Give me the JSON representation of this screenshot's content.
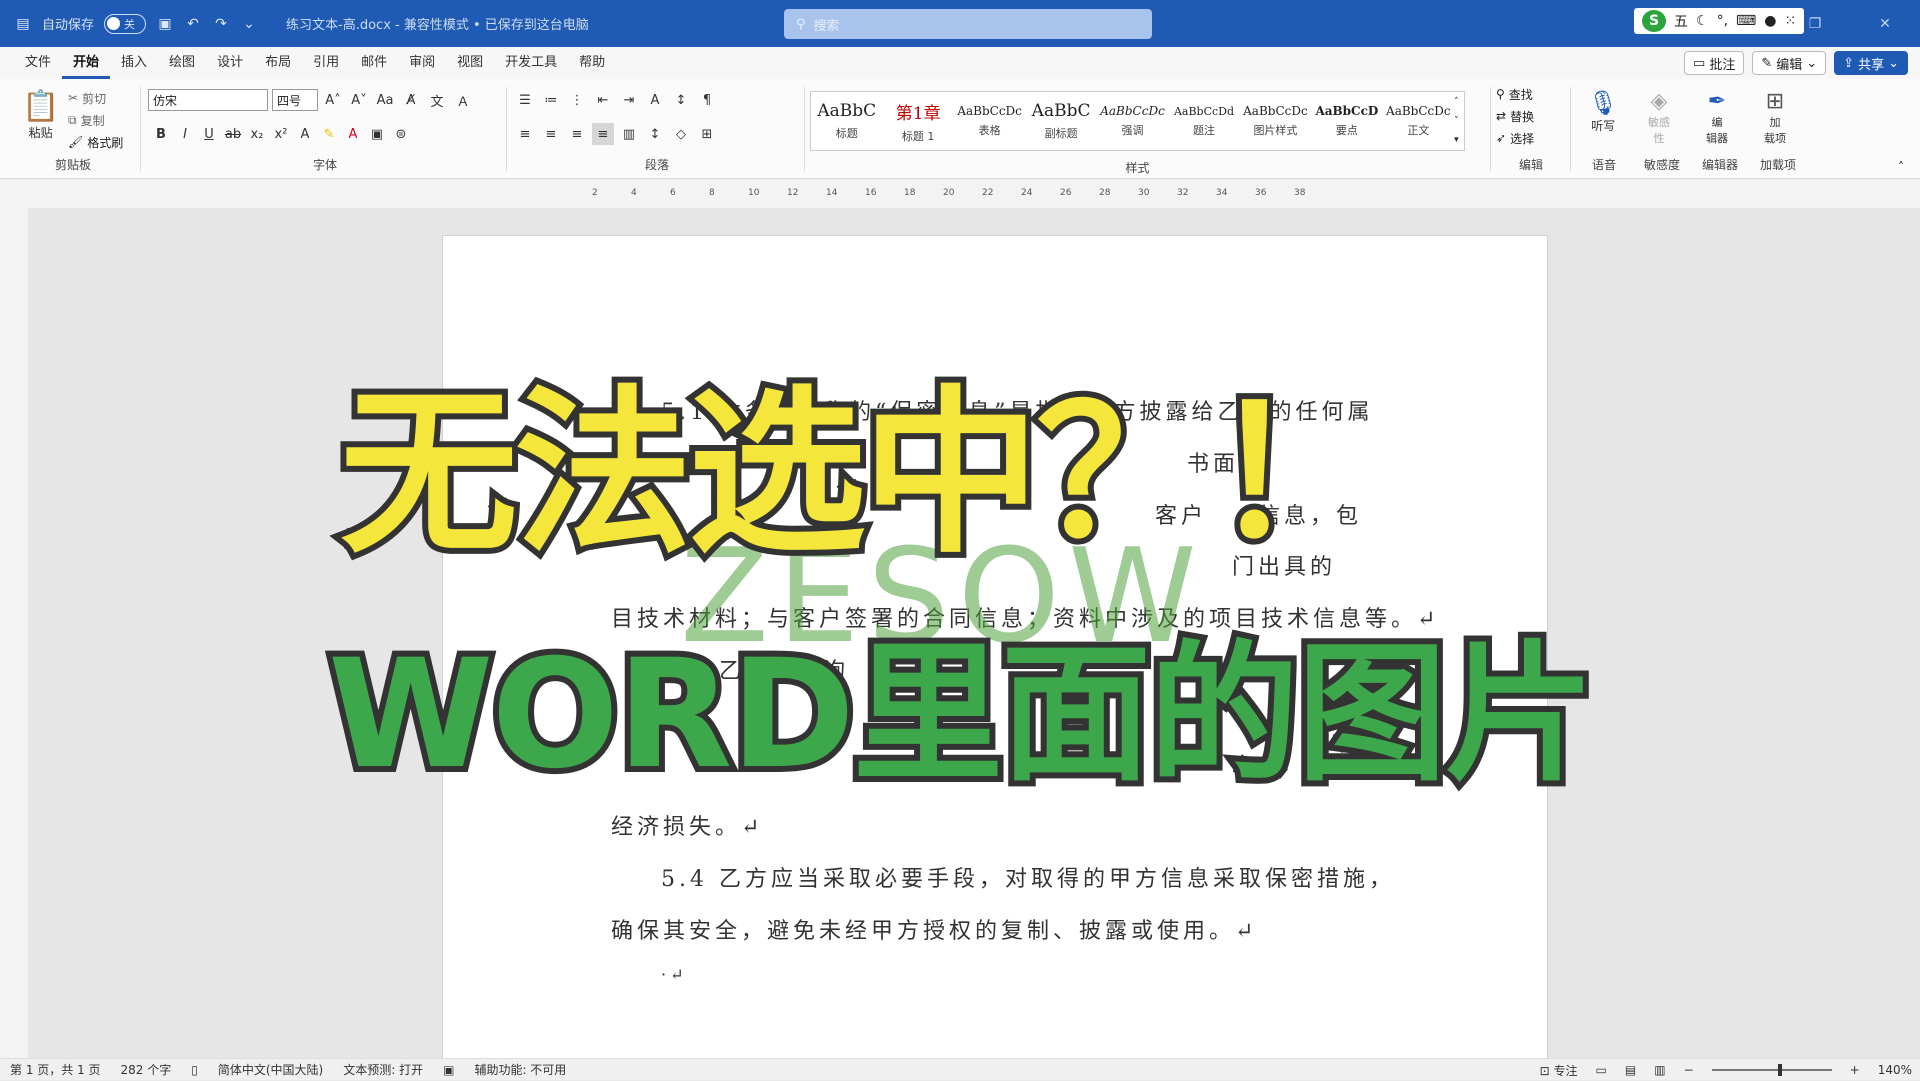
{
  "titlebar": {
    "autosave_label": "自动保存",
    "autosave_state": "关",
    "doc_title": "练习文本-高.docx  -  兼容性模式 • 已保存到这台电脑",
    "search_placeholder": "搜索",
    "ime_logo": "S",
    "ime_text": "五"
  },
  "menubar": {
    "tabs": [
      "文件",
      "开始",
      "插入",
      "绘图",
      "设计",
      "布局",
      "引用",
      "邮件",
      "审阅",
      "视图",
      "开发工具",
      "帮助"
    ],
    "active": "开始",
    "comments_label": "批注",
    "edit_label": "编辑",
    "share_label": "共享"
  },
  "ribbon": {
    "clipboard": {
      "paste": "粘贴",
      "cut": "剪切",
      "copy": "复制",
      "format_painter": "格式刷",
      "label": "剪贴板"
    },
    "font": {
      "font_name": "仿宋",
      "font_size": "四号",
      "label": "字体"
    },
    "paragraph": {
      "label": "段落"
    },
    "styles": {
      "items": [
        {
          "preview": "AaBbC",
          "name": "标题"
        },
        {
          "preview": "第1章",
          "name": "标题 1"
        },
        {
          "preview": "AaBbCcDc",
          "name": "表格"
        },
        {
          "preview": "AaBbC",
          "name": "副标题"
        },
        {
          "preview": "AaBbCcDc",
          "name": "强调"
        },
        {
          "preview": "AaBbCcDd",
          "name": "题注"
        },
        {
          "preview": "AaBbCcDc",
          "name": "图片样式"
        },
        {
          "preview": "AaBbCcD",
          "name": "要点"
        },
        {
          "preview": "AaBbCcDc",
          "name": "正文"
        }
      ],
      "label": "样式"
    },
    "editing": {
      "find": "查找",
      "replace": "替换",
      "select": "选择",
      "label": "编辑"
    },
    "voice": {
      "dictate": "听写",
      "label": "语音"
    },
    "sensitivity": {
      "btn": "敏感\n性",
      "label": "敏感度"
    },
    "editor": {
      "btn": "编\n辑器",
      "label": "编辑器"
    },
    "addins": {
      "btn": "加\n载项",
      "label": "加载项"
    }
  },
  "ruler": {
    "numbers": [
      "2",
      "4",
      "6",
      "8",
      "10",
      "12",
      "14",
      "16",
      "18",
      "20",
      "22",
      "24",
      "26",
      "28",
      "30",
      "32",
      "34",
      "36",
      "38"
    ]
  },
  "document": {
    "lines": [
      "5.1 本条款所称的“保密信息”是指，甲方披露给乙方的任何属",
      "书面或",
      "客户",
      "信息，包",
      "门出具的",
      "目技术材料；与客户签署的合同信息；资料中涉及的项目技术信息等。↵",
      "5.2 乙方对咨询",
      "经济损失。↵",
      "5.4 乙方应当采取必要手段，对取得的甲方信息采取保密措施，",
      "确保其安全，避免未经甲方授权的复制、披露或使用。↵",
      "·↵"
    ],
    "watermark": "ZESOW"
  },
  "overlay": {
    "line1": "无法选中？！",
    "line2": "WORD里面的图片"
  },
  "statusbar": {
    "page": "第 1 页，共 1 页",
    "words": "282 个字",
    "language": "简体中文(中国大陆)",
    "predict": "文本预测: 打开",
    "accessibility": "辅助功能: 不可用",
    "focus": "专注",
    "zoom": "140%"
  }
}
